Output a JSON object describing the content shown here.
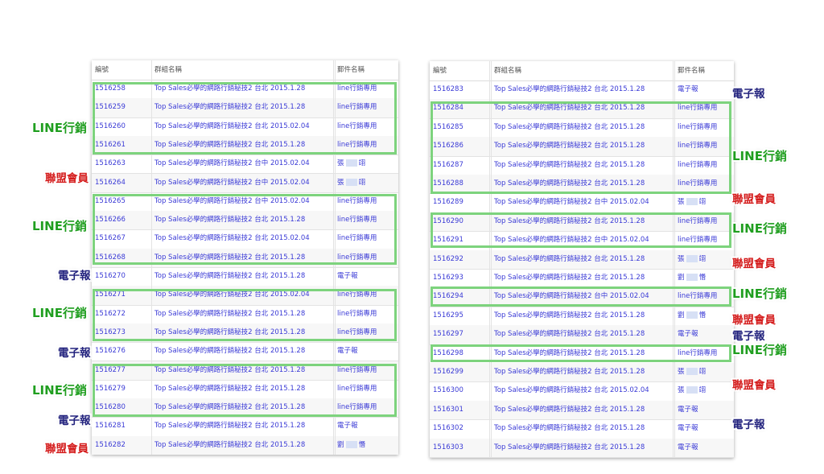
{
  "columns": {
    "id": "編號",
    "group": "群組名稱",
    "template": "郵件名稱"
  },
  "label_texts": {
    "line": "LINE行銷",
    "epaper": "電子報",
    "union": "聯盟會員"
  },
  "left_rows": [
    {
      "id": "1516258",
      "group": "Top Sales必學的網路行銷秘技2 台北 2015.1.28",
      "template": "line行銷專用"
    },
    {
      "id": "1516259",
      "group": "Top Sales必學的網路行銷秘技2 台北 2015.1.28",
      "template": "line行銷專用"
    },
    {
      "id": "1516260",
      "group": "Top Sales必學的網路行銷秘技2 台北 2015.02.04",
      "template": "line行銷專用"
    },
    {
      "id": "1516261",
      "group": "Top Sales必學的網路行銷秘技2 台北 2015.1.28",
      "template": "line行銷專用"
    },
    {
      "id": "1516263",
      "group": "Top Sales必學的網路行銷秘技2 台中 2015.02.04",
      "template": "張 __ 翊"
    },
    {
      "id": "1516264",
      "group": "Top Sales必學的網路行銷秘技2 台中 2015.02.04",
      "template": "張 __ 翊"
    },
    {
      "id": "1516265",
      "group": "Top Sales必學的網路行銷秘技2 台中 2015.02.04",
      "template": "line行銷專用"
    },
    {
      "id": "1516266",
      "group": "Top Sales必學的網路行銷秘技2 台北 2015.1.28",
      "template": "line行銷專用"
    },
    {
      "id": "1516267",
      "group": "Top Sales必學的網路行銷秘技2 台北 2015.02.04",
      "template": "line行銷專用"
    },
    {
      "id": "1516268",
      "group": "Top Sales必學的網路行銷秘技2 台北 2015.1.28",
      "template": "line行銷專用"
    },
    {
      "id": "1516270",
      "group": "Top Sales必學的網路行銷秘技2 台北 2015.1.28",
      "template": "電子報"
    },
    {
      "id": "1516271",
      "group": "Top Sales必學的網路行銷秘技2 台北 2015.02.04",
      "template": "line行銷專用"
    },
    {
      "id": "1516272",
      "group": "Top Sales必學的網路行銷秘技2 台北 2015.1.28",
      "template": "line行銷專用"
    },
    {
      "id": "1516273",
      "group": "Top Sales必學的網路行銷秘技2 台北 2015.1.28",
      "template": "line行銷專用"
    },
    {
      "id": "1516276",
      "group": "Top Sales必學的網路行銷秘技2 台北 2015.1.28",
      "template": "電子報"
    },
    {
      "id": "1516277",
      "group": "Top Sales必學的網路行銷秘技2 台北 2015.1.28",
      "template": "line行銷專用"
    },
    {
      "id": "1516279",
      "group": "Top Sales必學的網路行銷秘技2 台北 2015.1.28",
      "template": "line行銷專用"
    },
    {
      "id": "1516280",
      "group": "Top Sales必學的網路行銷秘技2 台北 2015.1.28",
      "template": "line行銷專用"
    },
    {
      "id": "1516281",
      "group": "Top Sales必學的網路行銷秘技2 台北 2015.1.28",
      "template": "電子報"
    },
    {
      "id": "1516282",
      "group": "Top Sales必學的網路行銷秘技2 台北 2015.1.28",
      "template": "劉 __ 惽"
    }
  ],
  "right_rows": [
    {
      "id": "1516283",
      "group": "Top Sales必學的網路行銷秘技2 台北 2015.1.28",
      "template": "電子報"
    },
    {
      "id": "1516284",
      "group": "Top Sales必學的網路行銷秘技2 台北 2015.1.28",
      "template": "line行銷專用"
    },
    {
      "id": "1516285",
      "group": "Top Sales必學的網路行銷秘技2 台北 2015.1.28",
      "template": "line行銷專用"
    },
    {
      "id": "1516286",
      "group": "Top Sales必學的網路行銷秘技2 台北 2015.1.28",
      "template": "line行銷專用"
    },
    {
      "id": "1516287",
      "group": "Top Sales必學的網路行銷秘技2 台北 2015.1.28",
      "template": "line行銷專用"
    },
    {
      "id": "1516288",
      "group": "Top Sales必學的網路行銷秘技2 台北 2015.1.28",
      "template": "line行銷專用"
    },
    {
      "id": "1516289",
      "group": "Top Sales必學的網路行銷秘技2 台中 2015.02.04",
      "template": "張 __ 翊"
    },
    {
      "id": "1516290",
      "group": "Top Sales必學的網路行銷秘技2 台北 2015.1.28",
      "template": "line行銷專用"
    },
    {
      "id": "1516291",
      "group": "Top Sales必學的網路行銷秘技2 台中 2015.02.04",
      "template": "line行銷專用"
    },
    {
      "id": "1516292",
      "group": "Top Sales必學的網路行銷秘技2 台北 2015.1.28",
      "template": "張 __ 翊"
    },
    {
      "id": "1516293",
      "group": "Top Sales必學的網路行銷秘技2 台北 2015.1.28",
      "template": "劉 __ 惽"
    },
    {
      "id": "1516294",
      "group": "Top Sales必學的網路行銷秘技2 台中 2015.02.04",
      "template": "line行銷專用"
    },
    {
      "id": "1516295",
      "group": "Top Sales必學的網路行銷秘技2 台北 2015.1.28",
      "template": "劉 __ 惽"
    },
    {
      "id": "1516297",
      "group": "Top Sales必學的網路行銷秘技2 台北 2015.1.28",
      "template": "電子報"
    },
    {
      "id": "1516298",
      "group": "Top Sales必學的網路行銷秘技2 台北 2015.1.28",
      "template": "line行銷專用"
    },
    {
      "id": "1516299",
      "group": "Top Sales必學的網路行銷秘技2 台北 2015.1.28",
      "template": "張 __ 翊"
    },
    {
      "id": "1516300",
      "group": "Top Sales必學的網路行銷秘技2 台北 2015.02.04",
      "template": "張 __ 翊"
    },
    {
      "id": "1516301",
      "group": "Top Sales必學的網路行銷秘技2 台北 2015.1.28",
      "template": "電子報"
    },
    {
      "id": "1516302",
      "group": "Top Sales必學的網路行銷秘技2 台北 2015.1.28",
      "template": "電子報"
    },
    {
      "id": "1516303",
      "group": "Top Sales必學的網路行銷秘技2 台北 2015.1.28",
      "template": "電子報"
    }
  ],
  "colors": {
    "line": "#1f9e1f",
    "epaper": "#23237e",
    "union": "#d41b1b",
    "highlight": "#7dd37d",
    "link": "#3a3ad6"
  }
}
